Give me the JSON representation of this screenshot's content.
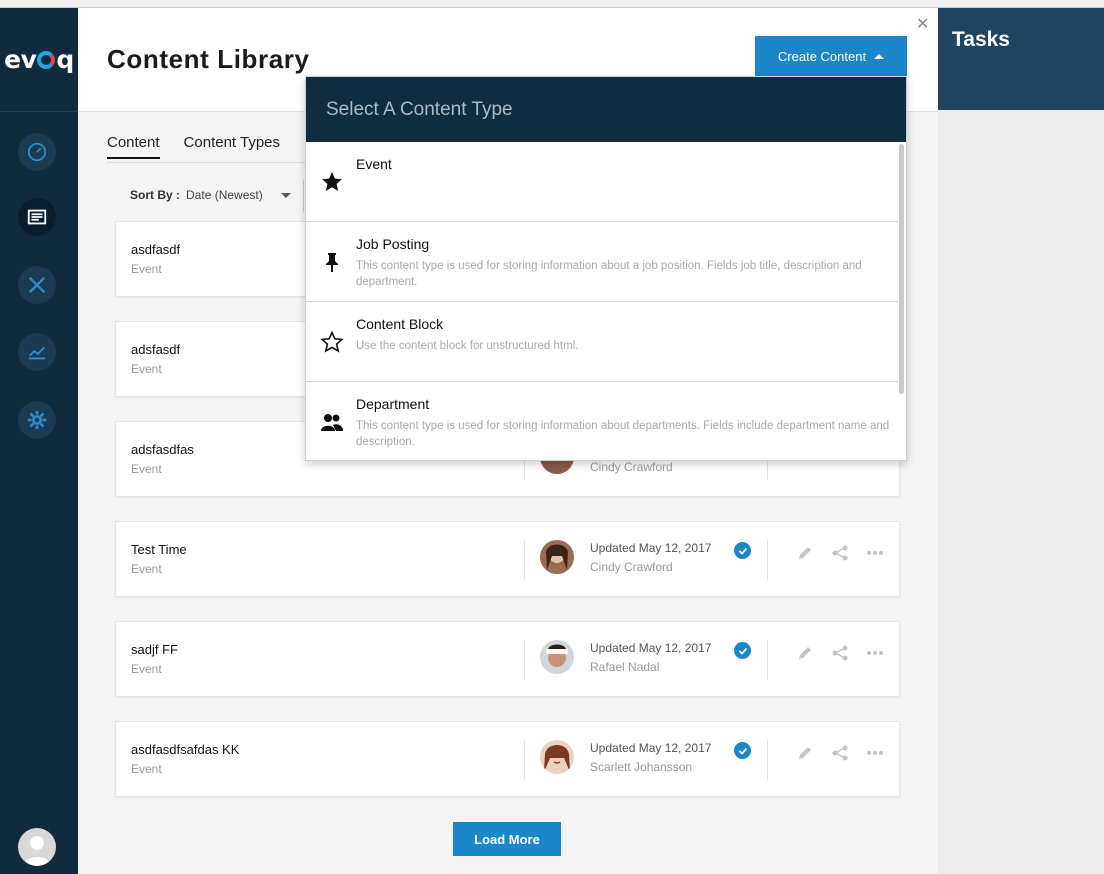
{
  "app": {
    "logo_text_pre": "ev",
    "logo_text_post": "q"
  },
  "header": {
    "title": "Content Library",
    "create_button": "Create Content"
  },
  "tabs": [
    {
      "label": "Content"
    },
    {
      "label": "Content Types"
    }
  ],
  "sort": {
    "label": "Sort By :",
    "value": "Date (Newest)"
  },
  "items": [
    {
      "title": "asdfasdf",
      "type": "Event",
      "updated": "",
      "author": ""
    },
    {
      "title": "adsfasdf",
      "type": "Event",
      "updated": "",
      "author": ""
    },
    {
      "title": "adsfasdfas",
      "type": "Event",
      "updated": "",
      "author": "Cindy Crawford"
    },
    {
      "title": "Test Time",
      "type": "Event",
      "updated": "Updated May 12, 2017",
      "author": "Cindy Crawford"
    },
    {
      "title": "sadjf FF",
      "type": "Event",
      "updated": "Updated May 12, 2017",
      "author": "Rafael Nadal"
    },
    {
      "title": "asdfasdfsafdas KK",
      "type": "Event",
      "updated": "Updated May 12, 2017",
      "author": "Scarlett Johansson"
    }
  ],
  "load_more": "Load More",
  "tasks": {
    "title": "Tasks"
  },
  "dropdown": {
    "title": "Select A Content Type",
    "options": [
      {
        "name": "Event",
        "description": "",
        "icon": "star-filled-icon"
      },
      {
        "name": "Job Posting",
        "description": "This content type is used for storing information about a job position. Fields job title, description and department.",
        "icon": "pin-icon"
      },
      {
        "name": "Content Block",
        "description": "Use the content block for unstructured html.",
        "icon": "star-outline-icon"
      },
      {
        "name": "Department",
        "description": "This content type is used for storing information about departments. Fields include department name and description.",
        "icon": "people-icon"
      }
    ]
  },
  "colors": {
    "sidebar": "#0f2b3d",
    "accent": "#1b87c9",
    "dropdown_header": "#0e2d40",
    "tasks_panel": "#1d4460"
  }
}
